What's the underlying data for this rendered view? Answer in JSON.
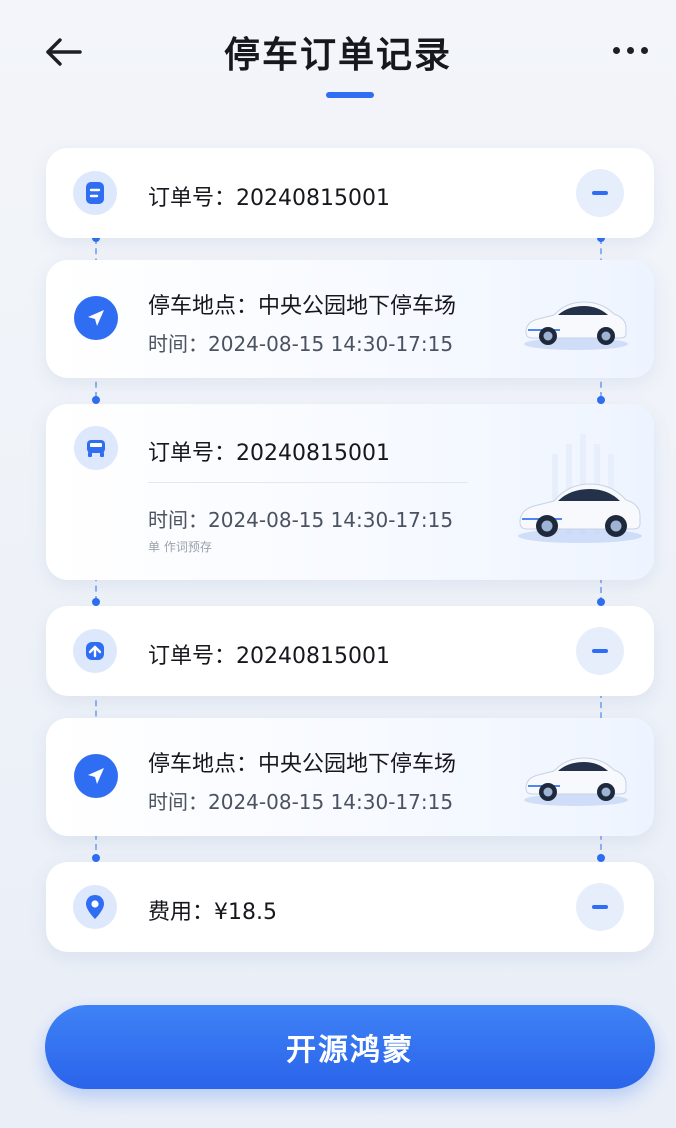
{
  "header": {
    "title": "停车订单记录"
  },
  "records": [
    {
      "order_label": "订单号：20240815001"
    },
    {
      "location_label": "停车地点：中央公园地下停车场",
      "time_label": "时间：2024-08-15 14:30-17:15"
    },
    {
      "order_label": "订单号：20240815001",
      "time_label": "时间：2024-08-15 14:30-17:15",
      "tiny_label": "单  作词预存"
    },
    {
      "order_label": "订单号：20240815001"
    },
    {
      "location_label": "停车地点：中央公园地下停车场",
      "time_label": "时间：2024-08-15 14:30-17:15"
    },
    {
      "fee_label": "费用：¥18.5"
    }
  ],
  "footer": {
    "button_label": "开源鸿蒙"
  },
  "colors": {
    "accent": "#2f6ef2",
    "accent_light": "#dde8fd"
  },
  "icons": {
    "back": "arrow-left-icon",
    "more": "more-dots-icon",
    "receipt": "receipt-icon",
    "navigate": "navigation-arrow-icon",
    "car": "car-icon",
    "upload": "arrow-up-icon",
    "location": "map-pin-icon",
    "minus": "minus-icon"
  }
}
